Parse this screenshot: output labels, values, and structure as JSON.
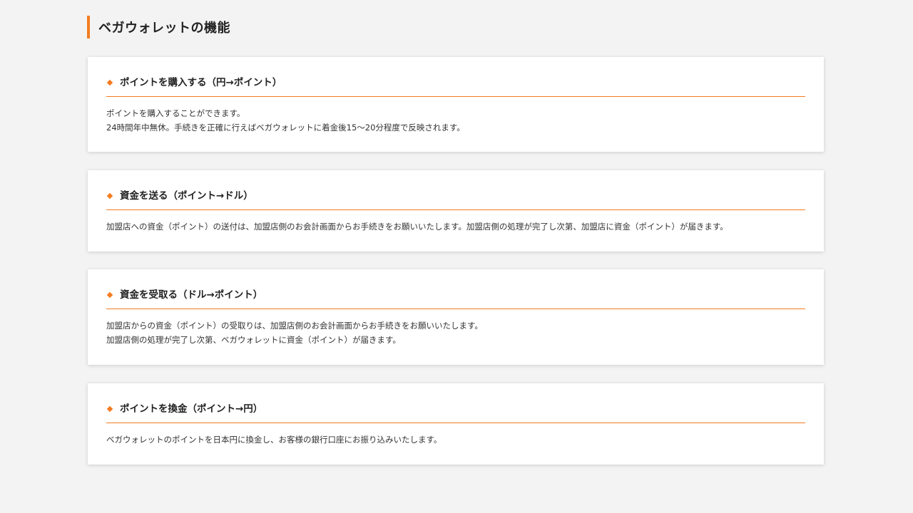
{
  "section": {
    "title": "ベガウォレットの機能"
  },
  "cards": [
    {
      "title": "ポイントを購入する（円→ポイント）",
      "lines": [
        "ポイントを購入することができます。",
        "24時間年中無休。手続きを正確に行えばベガウォレットに着金後15～20分程度で反映されます。"
      ]
    },
    {
      "title": "資金を送る（ポイント→ドル）",
      "lines": [
        "加盟店への資金（ポイント）の送付は、加盟店側のお会計画面からお手続きをお願いいたします。加盟店側の処理が完了し次第、加盟店に資金（ポイント）が届きます。"
      ]
    },
    {
      "title": "資金を受取る（ドル→ポイント）",
      "lines": [
        "加盟店からの資金（ポイント）の受取りは、加盟店側のお会計画面からお手続きをお願いいたします。",
        "加盟店側の処理が完了し次第、ベガウォレットに資金（ポイント）が届きます。"
      ]
    },
    {
      "title": "ポイントを換金（ポイント→円）",
      "lines": [
        "ベガウォレットのポイントを日本円に換金し、お客様の銀行口座にお振り込みいたします。"
      ]
    }
  ],
  "colors": {
    "accent": "#f47c20",
    "background": "#f3f3f3",
    "card": "#ffffff"
  },
  "icons": {
    "bullet": "diamond-icon"
  }
}
